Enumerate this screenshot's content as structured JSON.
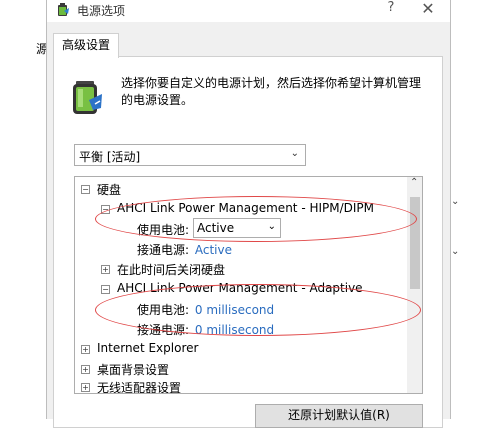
{
  "window": {
    "title": "电源选项",
    "help_glyph": "?",
    "close_glyph": "✕"
  },
  "background": {
    "left_char": "源",
    "right_arrow_down": "⌄"
  },
  "tabs": [
    {
      "label": "高级设置"
    }
  ],
  "instruction": "选择你要自定义的电源计划，然后选择你希望计算机管理的电源设置。",
  "plan_select": {
    "value": "平衡 [活动]"
  },
  "tree": {
    "items": [
      {
        "label": "硬盘",
        "expander": "⊟"
      },
      {
        "label": "AHCI Link Power Management - HIPM/DIPM",
        "expander": "⊟"
      },
      {
        "label": "使用电池:",
        "value": "Active"
      },
      {
        "label": "接通电源:",
        "value": "Active"
      },
      {
        "label": "在此时间后关闭硬盘",
        "expander": "⊞"
      },
      {
        "label": "AHCI Link Power Management - Adaptive",
        "expander": "⊟"
      },
      {
        "label": "使用电池:",
        "value": "0 millisecond"
      },
      {
        "label": "接通电源:",
        "value": "0 millisecond"
      },
      {
        "label": "Internet Explorer",
        "expander": "⊞"
      },
      {
        "label": "桌面背景设置",
        "expander": "⊞"
      },
      {
        "label": "无线适配器设置",
        "expander": "⊞"
      }
    ]
  },
  "restore_button": "还原计划默认值(R)",
  "colors": {
    "annotation": "#e04848",
    "link": "#2a6cbf"
  }
}
